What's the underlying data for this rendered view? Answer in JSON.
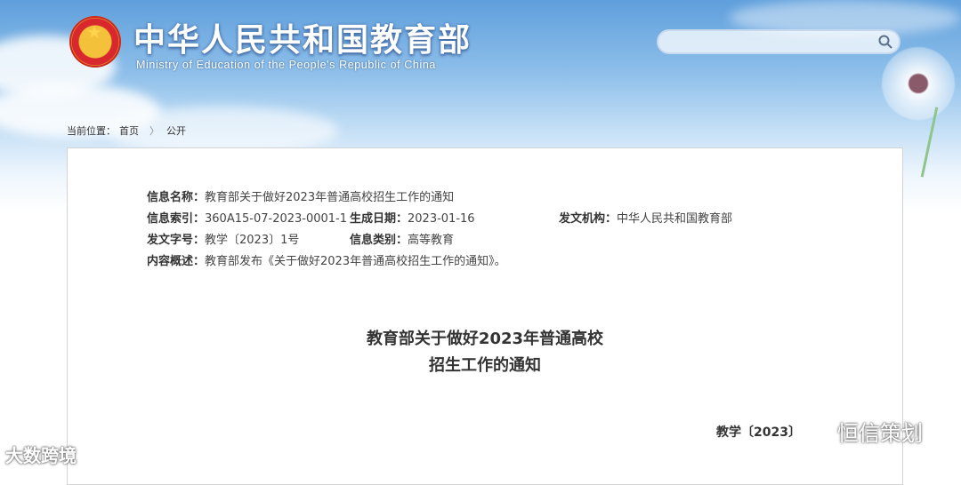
{
  "header": {
    "site_title": "中华人民共和国教育部",
    "site_subtitle": "Ministry of Education of the People's Republic of China"
  },
  "search": {
    "value": "",
    "placeholder": ""
  },
  "breadcrumb": {
    "prefix": "当前位置：",
    "items": [
      "首页",
      "公开"
    ]
  },
  "meta": {
    "name_label": "信息名称：",
    "name_value": "教育部关于做好2023年普通高校招生工作的通知",
    "index_label": "信息索引：",
    "index_value": "360A15-07-2023-0001-1",
    "date_label": "生成日期：",
    "date_value": "2023-01-16",
    "org_label": "发文机构：",
    "org_value": "中华人民共和国教育部",
    "docno_label": "发文字号：",
    "docno_value": "教学〔2023〕1号",
    "category_label": "信息类别：",
    "category_value": "高等教育",
    "summary_label": "内容概述：",
    "summary_value": "教育部发布《关于做好2023年普通高校招生工作的通知》。"
  },
  "document": {
    "title_line1": "教育部关于做好2023年普通高校",
    "title_line2": "招生工作的通知",
    "number_partial": "教学〔2023〕"
  },
  "watermarks": {
    "right": "恒信策划",
    "left": "大数跨境"
  }
}
